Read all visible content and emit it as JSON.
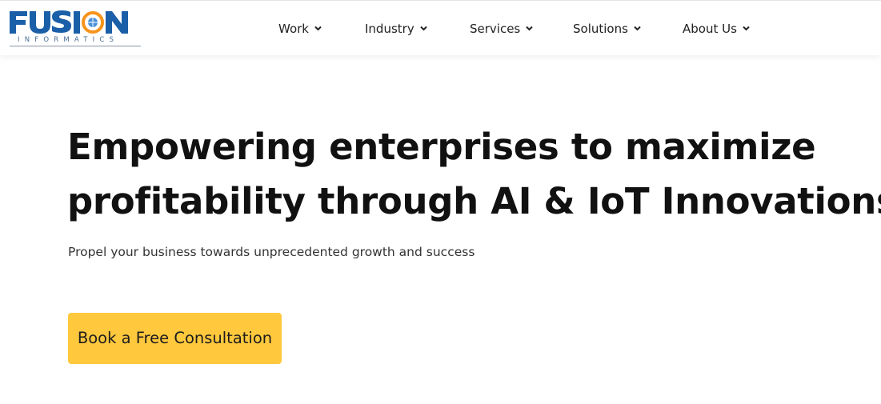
{
  "brand": {
    "logo_primary": "FUSION",
    "logo_secondary": "INFORMATICS",
    "colors": {
      "primary_blue": "#1B5FA8",
      "accent_orange": "#F7941D"
    }
  },
  "nav": {
    "items": [
      {
        "label": "Work",
        "icon": "chevron-down-icon"
      },
      {
        "label": "Industry",
        "icon": "chevron-down-icon"
      },
      {
        "label": "Services",
        "icon": "chevron-down-icon"
      },
      {
        "label": "Solutions",
        "icon": "chevron-down-icon"
      },
      {
        "label": "About Us",
        "icon": "chevron-down-icon"
      }
    ]
  },
  "hero": {
    "title_line_1": "Empowering enterprises to maximize",
    "title_line_2": "profitability through AI & IoT Innovations",
    "subtitle": "Propel your business towards unprecedented growth and success",
    "cta_label": "Book a Free Consultation",
    "cta_color": "#FFC83D"
  }
}
